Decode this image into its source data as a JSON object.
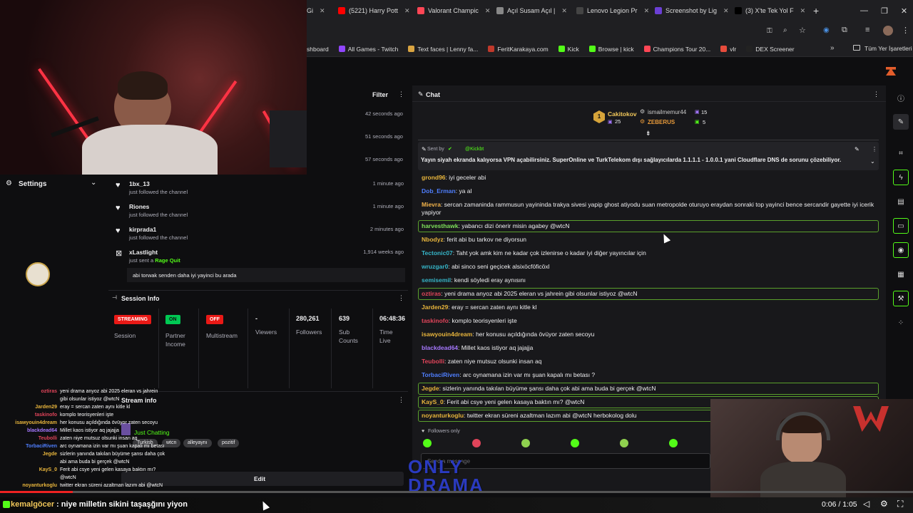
{
  "browser": {
    "tabs": [
      {
        "label": "Gi",
        "color": "#555"
      },
      {
        "label": "(5221) Harry Pott",
        "color": "#ff0000"
      },
      {
        "label": "Valorant Champic",
        "color": "#ff4655"
      },
      {
        "label": "Açıl Susam Açıl |",
        "color": "#888"
      },
      {
        "label": "Lenovo Legion Pr",
        "color": "#444"
      },
      {
        "label": "Screenshot by Lig",
        "color": "#6b3fd4"
      },
      {
        "label": "(3) X'te Tek Yol F",
        "color": "#000"
      }
    ],
    "new_tab": "+",
    "bookmarks": [
      {
        "label": "shboard",
        "color": "#555"
      },
      {
        "label": "All Games - Twitch",
        "color": "#9146ff"
      },
      {
        "label": "Text faces | Lenny fa...",
        "color": "#d9a441"
      },
      {
        "label": "FeritKarakaya.com",
        "color": "#c0392b"
      },
      {
        "label": "Kick",
        "color": "#53fc18"
      },
      {
        "label": "Browse | kick",
        "color": "#53fc18"
      },
      {
        "label": "Champions Tour 20...",
        "color": "#ff4655"
      },
      {
        "label": "vlr",
        "color": "#e74c3c"
      },
      {
        "label": "DEX Screener",
        "color": "#222"
      }
    ],
    "more_bookmarks": "»",
    "all_bookmarks": "Tüm Yer İşaretleri"
  },
  "activity": {
    "filter_label": "Filter",
    "rows_top": [
      {
        "time": "42 seconds ago"
      },
      {
        "time": "51 seconds ago"
      },
      {
        "time": "57 seconds ago"
      }
    ],
    "rows": [
      {
        "name": "1bx_13",
        "sub": "just followed the channel",
        "time": "1 minute ago",
        "icon": "heart-icon"
      },
      {
        "name": "Riones",
        "sub": "just followed the channel",
        "time": "1 minute ago",
        "icon": "heart-icon"
      },
      {
        "name": "kirprada1",
        "sub": "just followed the channel",
        "time": "2 minutes ago",
        "icon": "heart-icon"
      },
      {
        "name": "xLastlight",
        "sub_prefix": "just sent a ",
        "sub_highlight": "Rage Quit",
        "time": "1,914 weeks ago",
        "icon": "kick-icon"
      }
    ],
    "message": "abi torwak senden daha iyi yayinci bu arada"
  },
  "settings": {
    "label": "Settings"
  },
  "session": {
    "title": "Session Info",
    "streaming_badge": "STREAMING",
    "session_label": "Session",
    "on_badge": "ON",
    "partner_label": "Partner Income",
    "off_badge": "OFF",
    "multistream_label": "Multistream",
    "viewers_value": "-",
    "viewers_label": "Viewers",
    "followers_value": "280,261",
    "followers_label": "Followers",
    "subs_value": "639",
    "subs_label": "Sub Counts",
    "time_value": "06:48:36",
    "time_label": "Time Live"
  },
  "stream_info": {
    "title": "Stream info",
    "category": "Just Chatting",
    "tags": [
      "Turkish",
      "wtcn",
      "alleyaynı",
      "pozitif"
    ],
    "edit_label": "Edit"
  },
  "chat": {
    "title": "Chat",
    "leaderboard": {
      "first_name": "Cakitokov",
      "first_count": "25",
      "second_name": "ismailmemur44",
      "second_count": "15",
      "third_name": "ZEBERUS",
      "third_count": "5",
      "rank": "1"
    },
    "pinned": {
      "sent_by_label": "Sent by",
      "sent_by_user": "@Kickbt",
      "text": "Yayın siyah ekranda kalıyorsa VPN açabilirsiniz. SuperOnline ve TurkTelekom dışı sağlayıcılarda 1.1.1.1 - 1.0.0.1 yani Cloudflare DNS de sorunu çözebiliyor."
    },
    "messages": [
      {
        "user": "grond96",
        "color": "#e8b53c",
        "text": "iyi geceler abi"
      },
      {
        "user": "Dob_Erman",
        "color": "#4f7fff",
        "text": "ya al"
      },
      {
        "user": "Mievra",
        "color": "#f1b24a",
        "text": "sercan zamaninda rammusun yayininda trakya sivesi yapip ghost atiyodu suan metropolde oturuyo eraydan sonraki top yayinci bence sercandir gayette iyi icerik yapiyor"
      },
      {
        "user": "harvesthawk",
        "color": "#7ee05a",
        "text": "yabancı dizi önerir misin agabey @wtcN",
        "highlight": true
      },
      {
        "user": "Nbodyz",
        "color": "#e8b53c",
        "text": "ferit abi bu tarkov ne diyorsun"
      },
      {
        "user": "Tectonic07",
        "color": "#36b6c9",
        "text": "Taht yok amk kim ne kadar çok izlenirse o kadar iyi diğer yayıncılar için"
      },
      {
        "user": "wruzgar0",
        "color": "#36b6c9",
        "text": "abi sinco seni geçicek alsixöcföficöxl"
      },
      {
        "user": "semisemil",
        "color": "#36b6c9",
        "text": "kendi söyledi eray aynısını"
      },
      {
        "user": "oztiras",
        "color": "#e0445a",
        "text": "yeni drama anyoz abi 2025 eleran vs jahrein gibi olsunlar istiyoz @wtcN",
        "highlight": true
      },
      {
        "user": "Jarden29",
        "color": "#e8b53c",
        "text": "eray = sercan zaten aynı kitle kl"
      },
      {
        "user": "taskinofo",
        "color": "#e0445a",
        "text": "komplo teorisyenleri işte"
      },
      {
        "user": "isawyouin4dream",
        "color": "#e8b53c",
        "text": "her konusu açıldığında övüyor zaten secoyu"
      },
      {
        "user": "blackdead64",
        "color": "#a678ff",
        "text": "Millet kaos istiyor aq jajajja"
      },
      {
        "user": "Teubolli",
        "color": "#e0445a",
        "text": "zaten niye mutsuz olsunki insan aq"
      },
      {
        "user": "TorbaciRiven",
        "color": "#4f7fff",
        "text": "arc oynamana izin var mı şuan kapalı mı betası ?"
      },
      {
        "user": "Jegde",
        "color": "#e8b53c",
        "text": "sizlerin yanında takılan büyüme şansı daha çok abi ama buda bi gerçek @wtcN",
        "highlight": true
      },
      {
        "user": "KayS_0",
        "color": "#e8b53c",
        "text": "Ferit abi csye yeni gelen kasaya baktın mı? @wtcN",
        "highlight": true
      },
      {
        "user": "noyanturkoglu",
        "color": "#e8b53c",
        "text": "twitter ekran süreni azaltman lazım abi @wtcN herbokolog dolu",
        "highlight": true
      }
    ],
    "followers_only": "Followers only",
    "input_placeholder": "Send a message"
  },
  "overlay_chat": [
    {
      "user": "oztiras",
      "color": "#e0445a",
      "text": "yeni drama anyoz abi 2025 eleran vs jahrein"
    },
    {
      "user": "",
      "color": "#fff",
      "text": "gibi olsunlar istiyoz @wtcN"
    },
    {
      "user": "Jarden29",
      "color": "#e8b53c",
      "text": "eray = sercan zaten aynı kitle kl"
    },
    {
      "user": "taskinofo",
      "color": "#e0445a",
      "text": "komplo teorisyenleri işte"
    },
    {
      "user": "isawyouin4dream",
      "color": "#e8b53c",
      "text": "her konusu açıldığında övüyor zaten secoyu"
    },
    {
      "user": "blackdead64",
      "color": "#a678ff",
      "text": "Millet kaos istiyor aq jajajja"
    },
    {
      "user": "Teubolli",
      "color": "#e0445a",
      "text": "zaten niye mutsuz olsunki insan aq"
    },
    {
      "user": "TorbaciRiven",
      "color": "#4f7fff",
      "text": "arc oynamana izin var mı şuan kapalı mı betası"
    },
    {
      "user": "Jegde",
      "color": "#e8b53c",
      "text": "sizlerin yanında takılan büyüme şansı daha çok"
    },
    {
      "user": "",
      "color": "#fff",
      "text": "abi ama buda bi gerçek @wtcN"
    },
    {
      "user": "KayS_0",
      "color": "#e8b53c",
      "text": "Ferit abi csye yeni gelen kasaya baktın mı?"
    },
    {
      "user": "",
      "color": "#fff",
      "text": "@wtcN"
    },
    {
      "user": "noyanturkoglu",
      "color": "#e8b53c",
      "text": "twitter ekran süreni azaltman lazım abi @wtcN"
    }
  ],
  "bottom_banner": {
    "user": "kemalgöcer",
    "text": ": niye milletin sikini taşaşğını yiyon"
  },
  "video": {
    "time": "0:06 / 1:05"
  },
  "overlay_logo_text": "ONLY DRAMA",
  "accent_green": "#53fc18"
}
